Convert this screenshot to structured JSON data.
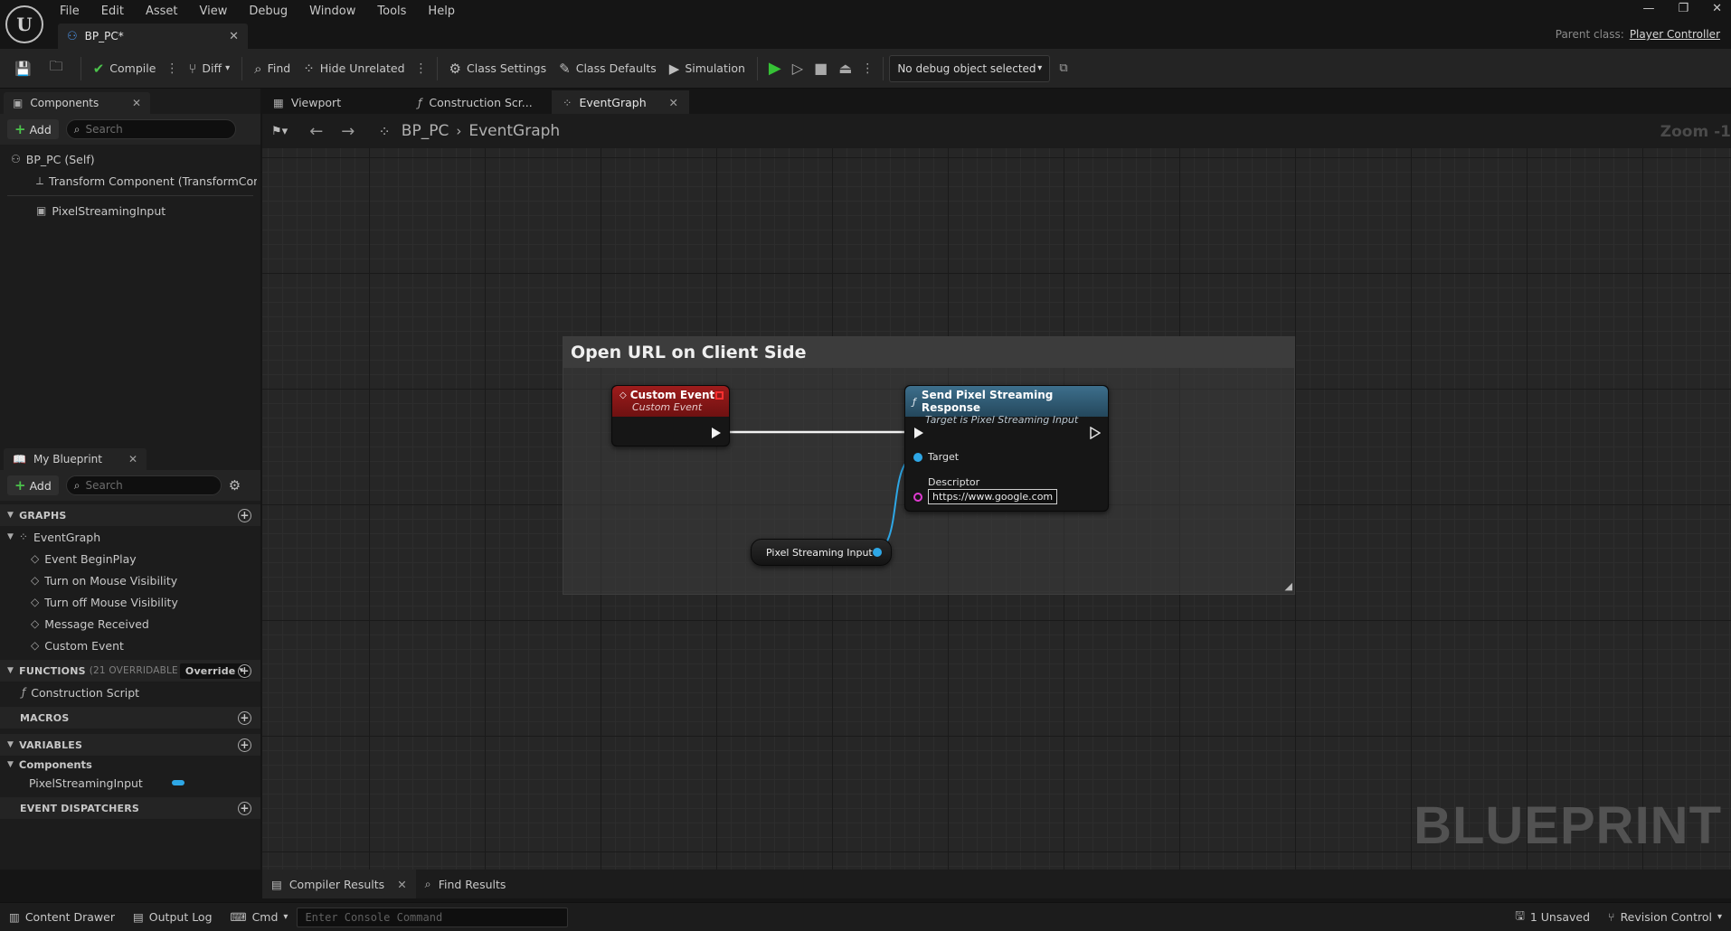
{
  "menu": [
    "File",
    "Edit",
    "Asset",
    "View",
    "Debug",
    "Window",
    "Tools",
    "Help"
  ],
  "document_tab": "BP_PC*",
  "parent_class": {
    "label": "Parent class:",
    "value": "Player Controller"
  },
  "toolbar": {
    "compile": "Compile",
    "diff": "Diff",
    "find": "Find",
    "hide_unrelated": "Hide Unrelated",
    "class_settings": "Class Settings",
    "class_defaults": "Class Defaults",
    "simulation": "Simulation",
    "debug_object": "No debug object selected"
  },
  "components_panel": {
    "tab": "Components",
    "add": "Add",
    "search_placeholder": "Search",
    "items": [
      "BP_PC (Self)",
      "Transform Component (TransformCom",
      "PixelStreamingInput"
    ]
  },
  "my_blueprint": {
    "tab": "My Blueprint",
    "add": "Add",
    "search_placeholder": "Search",
    "graphs_header": "GRAPHS",
    "event_graph": "EventGraph",
    "events": [
      "Event BeginPlay",
      "Turn on Mouse Visibility",
      "Turn off Mouse Visibility",
      "Message Received",
      "Custom Event"
    ],
    "functions_header": "FUNCTIONS",
    "functions_count": "(21 OVERRIDABLE",
    "override": "Override",
    "construction_script": "Construction Script",
    "macros_header": "MACROS",
    "variables_header": "VARIABLES",
    "components_group": "Components",
    "variable": "PixelStreamingInput",
    "dispatchers_header": "EVENT DISPATCHERS"
  },
  "editor_tabs": [
    "Viewport",
    "Construction Scr...",
    "EventGraph"
  ],
  "breadcrumb": {
    "root": "BP_PC",
    "current": "EventGraph"
  },
  "zoom": "Zoom -1",
  "watermark": "BLUEPRINT",
  "graph": {
    "comment": "Open URL on Client Side",
    "custom_event": {
      "title": "Custom Event",
      "subtitle": "Custom Event"
    },
    "send_node": {
      "title": "Send Pixel Streaming Response",
      "subtitle": "Target is Pixel Streaming Input",
      "target": "Target",
      "descriptor": "Descriptor",
      "descriptor_value": "https://www.google.com"
    },
    "variable_node": "Pixel Streaming Input"
  },
  "bottom_tabs": [
    "Compiler Results",
    "Find Results"
  ],
  "statusbar": {
    "content_drawer": "Content Drawer",
    "output_log": "Output Log",
    "cmd": "Cmd",
    "console_placeholder": "Enter Console Command",
    "unsaved": "1 Unsaved",
    "revision_control": "Revision Control"
  },
  "colors": {
    "exec_pin": "#f2f2f2",
    "object_pin": "#2ea7e6",
    "string_pin": "#e03ad2",
    "event_header": "#8f1a1a",
    "function_header": "#2f5a73"
  }
}
